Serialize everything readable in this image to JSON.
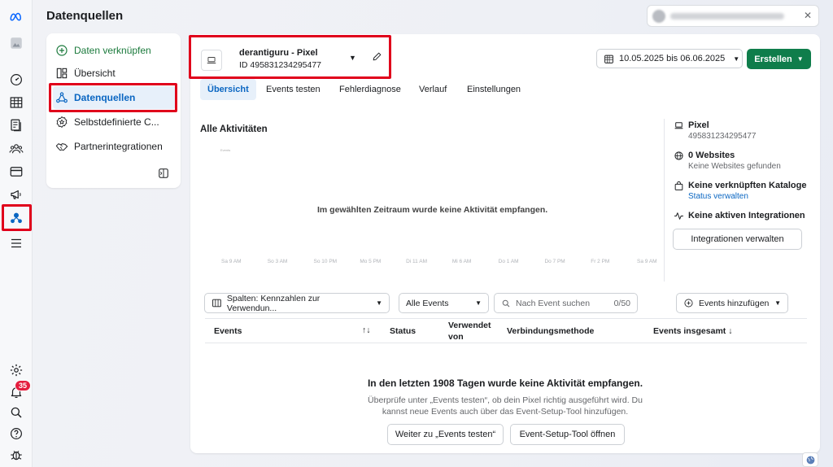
{
  "page": {
    "title": "Datenquellen"
  },
  "colors": {
    "accent_blue": "#0a66c2",
    "primary_green": "#0f7d4b",
    "highlight_red": "#e0001b",
    "badge_red": "#e41e3f"
  },
  "rail": {
    "notifications_badge": "35"
  },
  "nav": {
    "connect_data": "Daten verknüpfen",
    "items": [
      {
        "label": "Übersicht",
        "icon": "layout-icon"
      },
      {
        "label": "Datenquellen",
        "icon": "data-sources-icon",
        "active": true
      },
      {
        "label": "Selbstdefinierte C...",
        "icon": "badge-star-icon"
      },
      {
        "label": "Partnerintegrationen",
        "icon": "handshake-icon"
      }
    ]
  },
  "pixel": {
    "name": "derantiguru - Pixel",
    "id": "ID 495831234295477"
  },
  "toolbar": {
    "date_range": "10.05.2025 bis 06.06.2025",
    "create_label": "Erstellen"
  },
  "tabs": [
    "Übersicht",
    "Events testen",
    "Fehlerdiagnose",
    "Verlauf",
    "Einstellungen"
  ],
  "activity": {
    "title": "Alle Aktivitäten",
    "empty_message": "Im gewählten Zeitraum wurde keine Aktivität empfangen.",
    "y_label": "Events",
    "x_ticks": [
      "Sa 9 AM",
      "So 3 AM",
      "So 10 PM",
      "Mo 5 PM",
      "Di 11 AM",
      "Mi 6 AM",
      "Do 1 AM",
      "Do 7 PM",
      "Fr 2 PM",
      "Sa 9 AM"
    ]
  },
  "sidebar_info": {
    "pixel_title": "Pixel",
    "pixel_id": "495831234295477",
    "websites_title": "0 Websites",
    "websites_sub": "Keine Websites gefunden",
    "catalog_title": "Keine verknüpften Kataloge",
    "catalog_link": "Status verwalten",
    "integrations_title": "Keine aktiven Integrationen",
    "manage_integrations": "Integrationen verwalten"
  },
  "filters": {
    "columns": "Spalten: Kennzahlen zur Verwendun...",
    "events": "Alle Events",
    "search_placeholder": "Nach Event suchen",
    "search_count": "0/50",
    "add_events": "Events hinzufügen"
  },
  "table": {
    "headers": {
      "events": "Events",
      "status": "Status",
      "used_by_1": "Verwendet",
      "used_by_2": "von",
      "method": "Verbindungsmethode",
      "total": "Events insgesamt ↓"
    },
    "sort_icon": "↑↓"
  },
  "empty_state": {
    "title": "In den letzten 1908 Tagen wurde keine Aktivität empfangen.",
    "subtitle": "Überprüfe unter „Events testen“, ob dein Pixel richtig ausgeführt wird. Du kannst neue Events auch über das Event-Setup-Tool hinzufügen.",
    "btn_test": "Weiter zu „Events testen“",
    "btn_setup": "Event-Setup-Tool öffnen"
  }
}
